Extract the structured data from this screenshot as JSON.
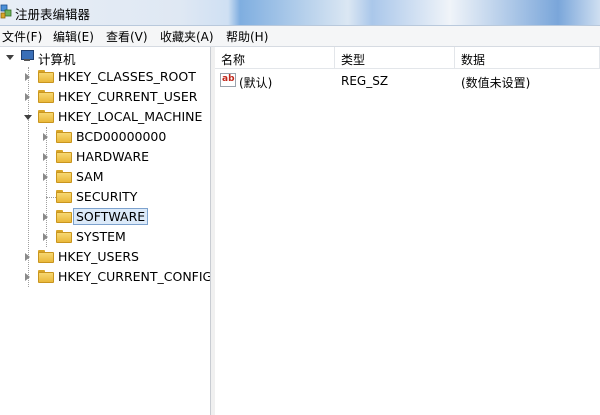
{
  "window": {
    "title": "注册表编辑器"
  },
  "menu": {
    "items": [
      "文件(F)",
      "编辑(E)",
      "查看(V)",
      "收藏夹(A)",
      "帮助(H)"
    ]
  },
  "tree": {
    "root": "计算机",
    "hives": {
      "classes_root": "HKEY_CLASSES_ROOT",
      "current_user": "HKEY_CURRENT_USER",
      "local_machine": "HKEY_LOCAL_MACHINE",
      "users": "HKEY_USERS",
      "current_config": "HKEY_CURRENT_CONFIG"
    },
    "local_machine_children": [
      "BCD00000000",
      "HARDWARE",
      "SAM",
      "SECURITY",
      "SOFTWARE",
      "SYSTEM"
    ],
    "selected": "SOFTWARE"
  },
  "values_list": {
    "columns": [
      "名称",
      "类型",
      "数据"
    ],
    "rows": [
      {
        "name": "(默认)",
        "type": "REG_SZ",
        "data": "(数值未设置)"
      }
    ]
  },
  "colors": {
    "selection_border": "#7da2ce",
    "selection_fill": "#dceaf9",
    "folder": "#e9b83a"
  },
  "icons": {
    "app": "registry-editor-icon",
    "root": "computer-icon",
    "key": "folder-icon",
    "string_value": "ab-string-value-icon"
  }
}
